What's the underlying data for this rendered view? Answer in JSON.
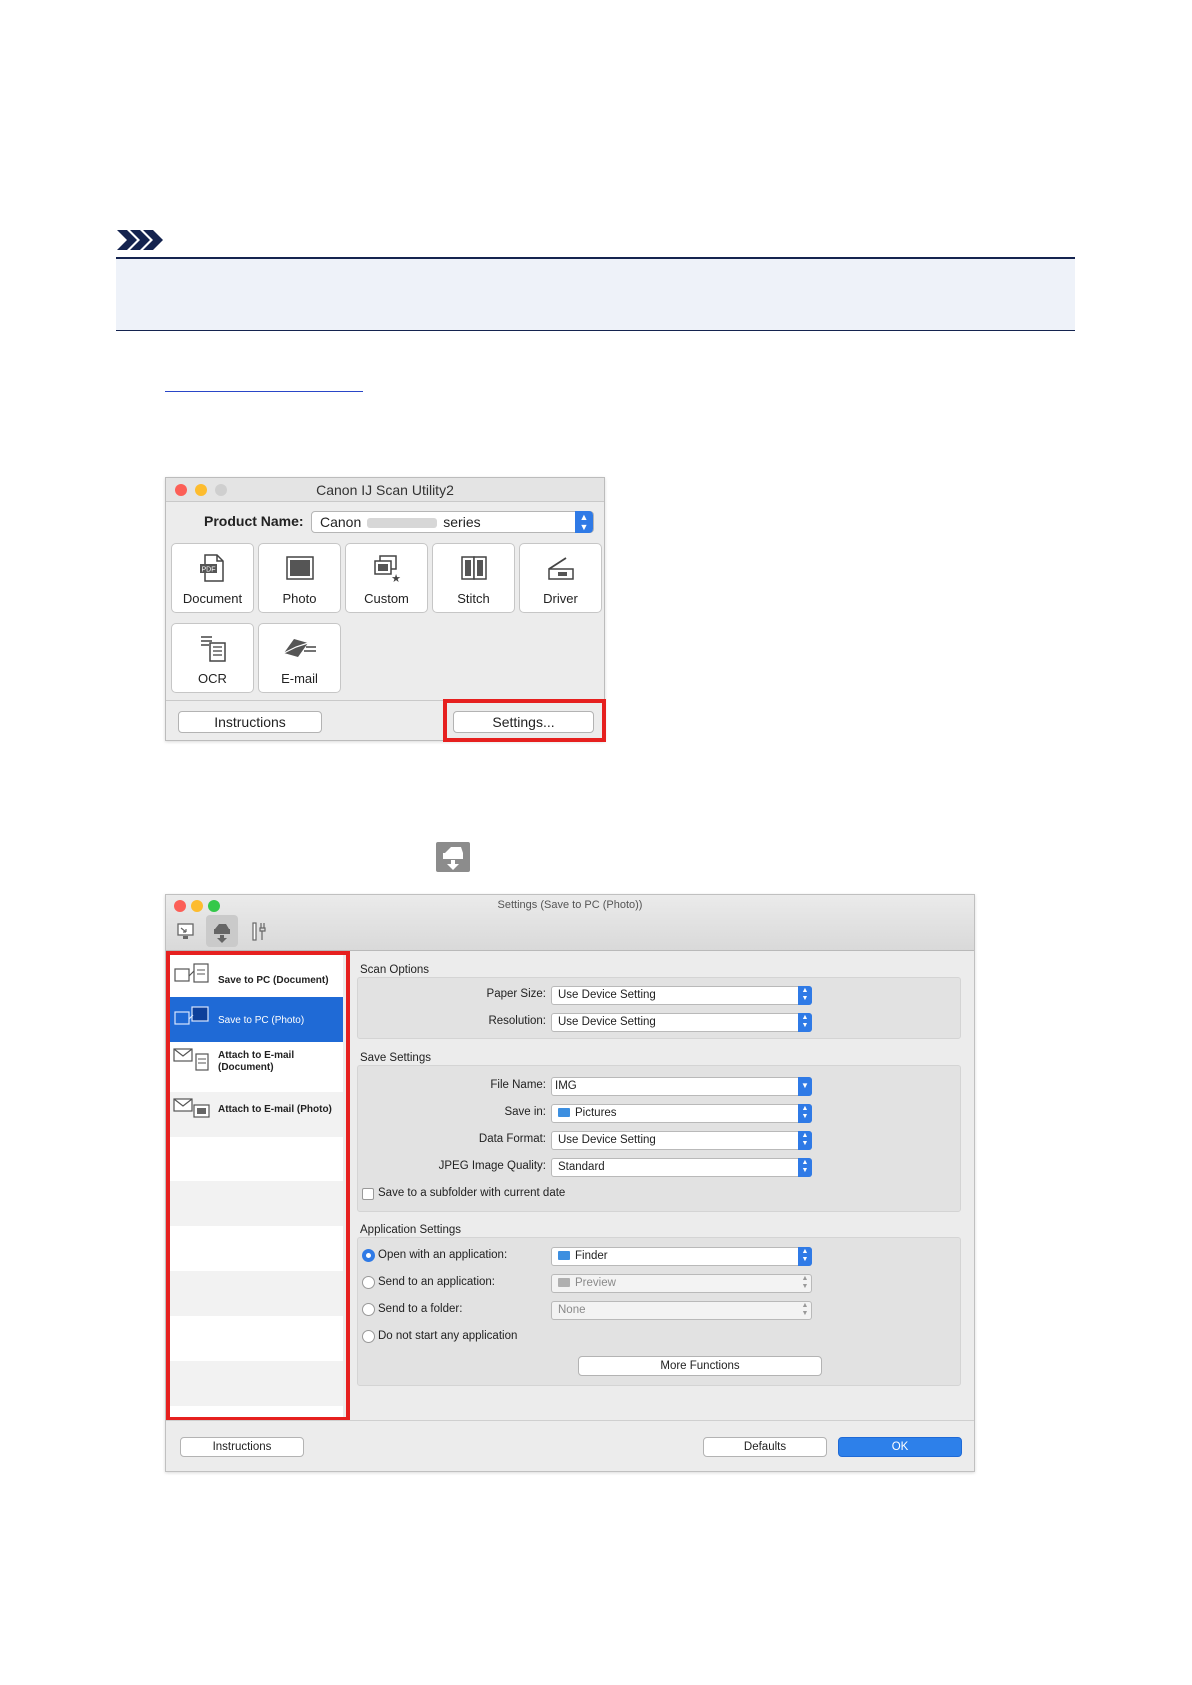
{
  "scan_utility": {
    "window_title": "Canon IJ Scan Utility2",
    "product_label": "Product Name:",
    "product_value_left": "Canon",
    "product_value_right": "series",
    "tiles": [
      "Document",
      "Photo",
      "Custom",
      "Stitch",
      "Driver",
      "OCR",
      "E-mail"
    ],
    "instructions_button": "Instructions",
    "settings_button": "Settings..."
  },
  "settings": {
    "window_title": "Settings (Save to PC (Photo))",
    "list_items": [
      "Save to PC (Document)",
      "Save to PC (Photo)",
      "Attach to E-mail\n(Document)",
      "Attach to E-mail (Photo)"
    ],
    "scan_options": {
      "title": "Scan Options",
      "paper_size_label": "Paper Size:",
      "paper_size_value": "Use Device Setting",
      "resolution_label": "Resolution:",
      "resolution_value": "Use Device Setting"
    },
    "save_settings": {
      "title": "Save Settings",
      "file_name_label": "File Name:",
      "file_name_value": "IMG",
      "save_in_label": "Save in:",
      "save_in_value": "Pictures",
      "data_format_label": "Data Format:",
      "data_format_value": "Use Device Setting",
      "jpeg_label": "JPEG Image Quality:",
      "jpeg_value": "Standard",
      "subfolder_label": "Save to a subfolder with current date"
    },
    "application_settings": {
      "title": "Application Settings",
      "open_label": "Open with an application:",
      "open_value": "Finder",
      "send_app_label": "Send to an application:",
      "send_app_value": "Preview",
      "send_folder_label": "Send to a folder:",
      "send_folder_value": "None",
      "none_label": "Do not start any application",
      "more_button": "More Functions"
    },
    "instructions_button": "Instructions",
    "defaults_button": "Defaults",
    "ok_button": "OK"
  }
}
